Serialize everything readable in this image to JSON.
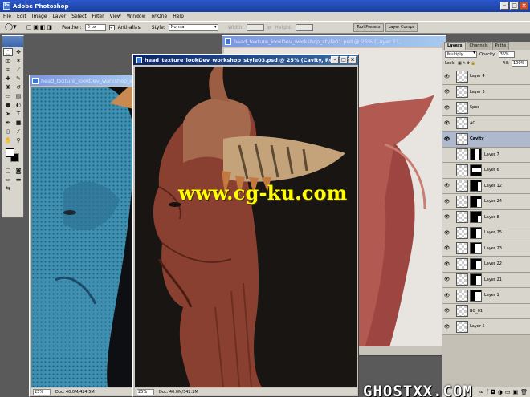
{
  "app": {
    "title": "Adobe Photoshop"
  },
  "menu": [
    "File",
    "Edit",
    "Image",
    "Layer",
    "Select",
    "Filter",
    "View",
    "Window",
    "onOne",
    "Help"
  ],
  "options": {
    "feather_label": "Feather:",
    "feather_value": "0 px",
    "antialias_label": "Anti-alias",
    "style_label": "Style:",
    "style_value": "Normal",
    "width_label": "Width:",
    "height_label": "Height:"
  },
  "palette_well": {
    "tabs": [
      "Tool Presets",
      "Layer Comps"
    ]
  },
  "documents": [
    {
      "id": "left",
      "title": "head_texture_lookDev_workshop_style0",
      "zoom": "25%",
      "doc_info": "Doc: 40.0M/424.5M"
    },
    {
      "id": "center",
      "title": "head_texture_lookDev_workshop_style03.psd @ 25% (Cavity, RGB/8#)",
      "zoom": "25%",
      "doc_info": "Doc: 40.0M/542.2M"
    },
    {
      "id": "right",
      "title": "head_texture_lookDev_workshop_style01.psd @ 25% (Layer 11,",
      "zoom": "",
      "doc_info": ""
    }
  ],
  "layers_panel": {
    "tabs": [
      "Layers",
      "Channels",
      "Paths"
    ],
    "blend_mode": "Multiply",
    "opacity_label": "Opacity:",
    "opacity_value": "35%",
    "lock_label": "Lock:",
    "fill_label": "Fill:",
    "fill_value": "100%",
    "layers": [
      {
        "name": "Layer 4",
        "visible": true,
        "mask": false,
        "selected": false
      },
      {
        "name": "Layer 3",
        "visible": true,
        "mask": false,
        "selected": false
      },
      {
        "name": "Spec",
        "visible": true,
        "mask": false,
        "selected": false
      },
      {
        "name": "AO",
        "visible": true,
        "mask": false,
        "selected": false
      },
      {
        "name": "Cavity",
        "visible": true,
        "mask": false,
        "selected": true
      },
      {
        "name": "Layer 7",
        "visible": false,
        "mask": true,
        "selected": false
      },
      {
        "name": "Layer 6",
        "visible": false,
        "mask": true,
        "selected": false
      },
      {
        "name": "Layer 12",
        "visible": true,
        "mask": true,
        "selected": false
      },
      {
        "name": "Layer 24",
        "visible": true,
        "mask": true,
        "selected": false
      },
      {
        "name": "Layer 8",
        "visible": true,
        "mask": true,
        "selected": false
      },
      {
        "name": "Layer 25",
        "visible": true,
        "mask": true,
        "selected": false
      },
      {
        "name": "Layer 23",
        "visible": true,
        "mask": true,
        "selected": false
      },
      {
        "name": "Layer 22",
        "visible": true,
        "mask": true,
        "selected": false
      },
      {
        "name": "Layer 21",
        "visible": true,
        "mask": true,
        "selected": false
      },
      {
        "name": "Layer 1",
        "visible": true,
        "mask": true,
        "selected": false
      },
      {
        "name": "BG_01",
        "visible": true,
        "mask": false,
        "selected": false
      },
      {
        "name": "Layer 5",
        "visible": true,
        "mask": false,
        "selected": false
      }
    ]
  },
  "watermarks": {
    "url": "www.cg-ku.com",
    "bottom": "GHOSTXX.COM"
  },
  "colors": {
    "title_active": "#0a246a",
    "ui_face": "#d8d5cc",
    "watermark": "#ffff00"
  }
}
